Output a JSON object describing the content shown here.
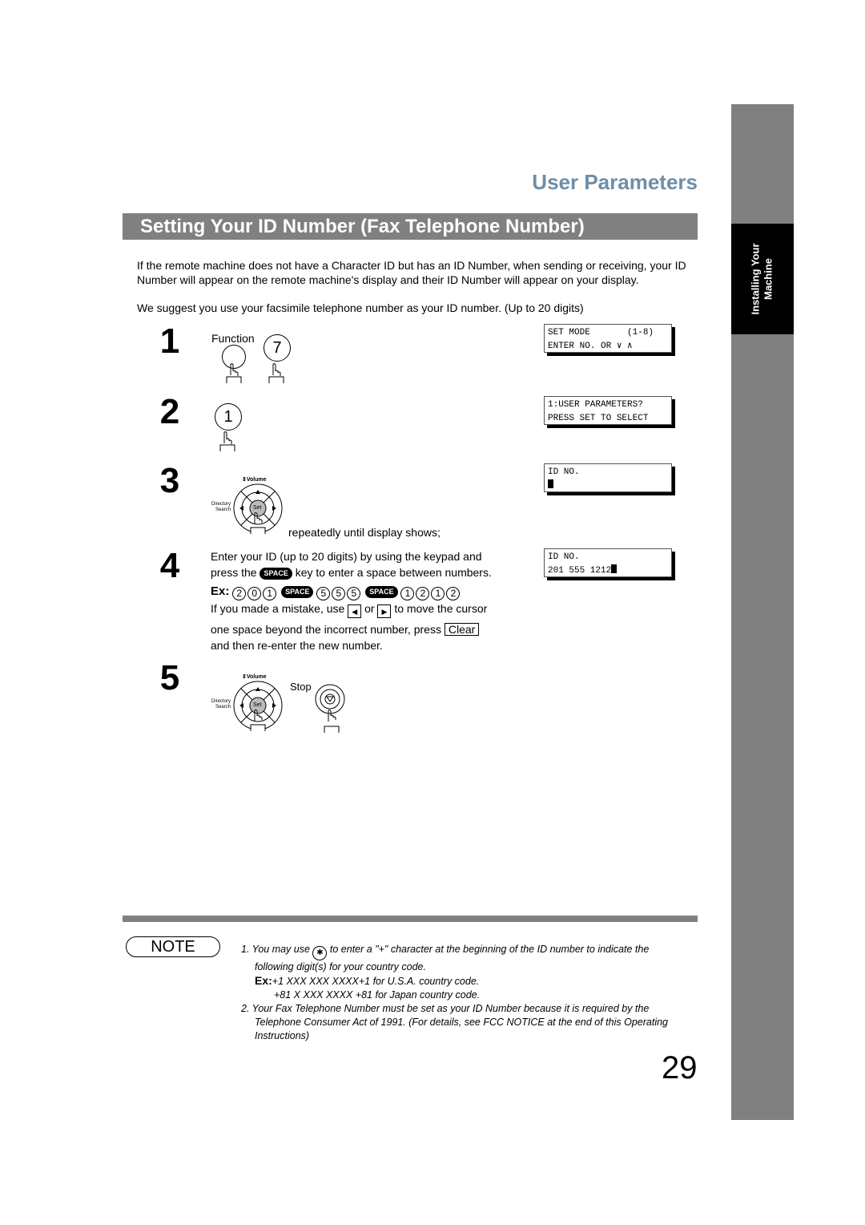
{
  "sidebar": {
    "tab_line1": "Installing Your",
    "tab_line2": "Machine"
  },
  "header": {
    "section_title": "User Parameters",
    "page_title": "Setting Your ID Number (Fax Telephone Number)"
  },
  "intro": {
    "paragraph1": "If the remote machine does not have a Character ID but has an ID Number, when sending or receiving, your ID Number will appear on the remote machine's display and their ID Number will appear on your display.",
    "paragraph2": "We suggest you use your facsimile telephone number as your ID number. (Up to 20 digits)"
  },
  "steps": [
    {
      "number": "1",
      "function_label": "Function",
      "key": "7",
      "lcd_line1": "SET MODE       (1-8)",
      "lcd_line2": "ENTER NO. OR ∨ ∧"
    },
    {
      "number": "2",
      "key": "1",
      "lcd_line1": "1:USER PARAMETERS?",
      "lcd_line2": "PRESS SET TO SELECT"
    },
    {
      "number": "3",
      "instruction": "repeatedly until display shows;",
      "lcd_line1": "ID NO.",
      "lcd_line2": ""
    },
    {
      "number": "4",
      "line1": "Enter your ID (up to 20 digits) by using the keypad and",
      "line2_a": "press the",
      "line2_b": "key to enter a space between numbers.",
      "example_label": "Ex:",
      "example_group1": [
        "2",
        "0",
        "1"
      ],
      "example_group2": [
        "5",
        "5",
        "5"
      ],
      "example_group3": [
        "1",
        "2",
        "1",
        "2"
      ],
      "mistake_a": "If you made a mistake, use",
      "mistake_or": "or",
      "mistake_b": "to move the cursor",
      "mistake_c": "one space beyond the incorrect number, press",
      "mistake_d": "and then re-enter the new number.",
      "clear_label": "Clear",
      "lcd_line1": "ID NO.",
      "lcd_line2": "201 555 1212"
    },
    {
      "number": "5",
      "stop_label": "Stop"
    }
  ],
  "keys": {
    "space_label": "SPACE",
    "volume_label": "Volume",
    "directory_label1": "Directory",
    "directory_label2": "Search",
    "set_label": "Set",
    "left_arrow": "◀",
    "right_arrow": "▶"
  },
  "note": {
    "label": "NOTE",
    "item1_a": "1.  You may use",
    "item1_b": "to enter a \"+\" character at the beginning of the ID number to indicate the",
    "item1_c": "following digit(s) for your country code.",
    "ex_label": "Ex:",
    "ex1": "+1 XXX XXX XXXX+1 for U.S.A. country code.",
    "ex2": "+81 X XXX XXXX  +81 for Japan country code.",
    "item2_a": "2.  Your Fax Telephone Number must be set as your ID Number because it is required by the",
    "item2_b": "Telephone Consumer Act of 1991. (For details, see FCC NOTICE at the end of this Operating",
    "item2_c": "Instructions)",
    "star_symbol": "✱"
  },
  "page_number": "29"
}
